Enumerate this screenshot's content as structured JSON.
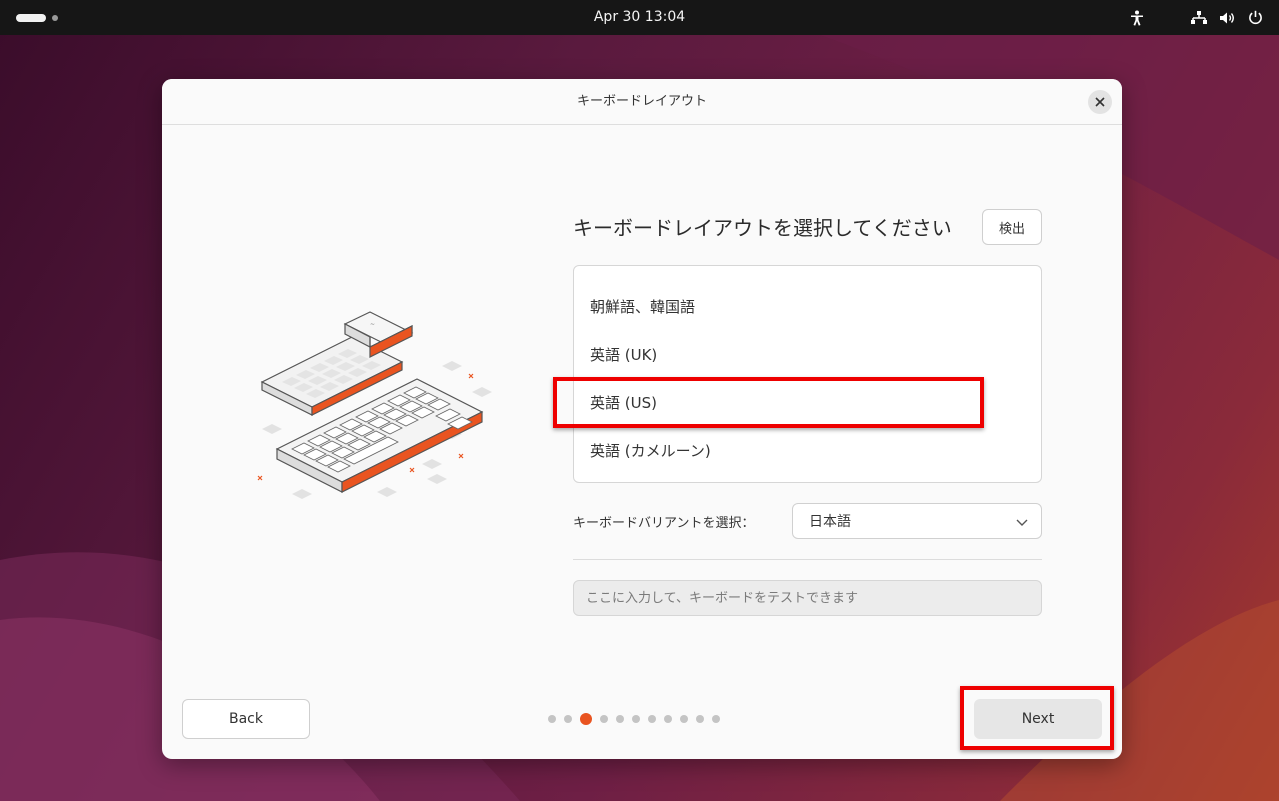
{
  "topbar": {
    "clock": "Apr 30  13:04",
    "icons": [
      "activities-pill-icon",
      "workspace-dot-icon",
      "accessibility-icon",
      "network-icon",
      "volume-icon",
      "power-icon"
    ]
  },
  "dialog": {
    "title": "キーボードレイアウト",
    "heading": "キーボードレイアウトを選択してください",
    "detect_label": "検出",
    "layouts": [
      "朝鮮語、韓国語",
      "英語 (UK)",
      "英語 (US)",
      "英語 (カメルーン)"
    ],
    "selected_layout": "英語 (US)",
    "variant_label": "キーボードバリアントを選択：",
    "variant_value": "日本語",
    "test_placeholder": "ここに入力して、キーボードをテストできます",
    "back_label": "Back",
    "next_label": "Next",
    "page_dots_total": 11,
    "page_dots_active": 3
  },
  "colors": {
    "accent": "#e95420",
    "highlight": "#ee0000",
    "topbar": "#161616",
    "dialog_bg": "#fafafa"
  }
}
